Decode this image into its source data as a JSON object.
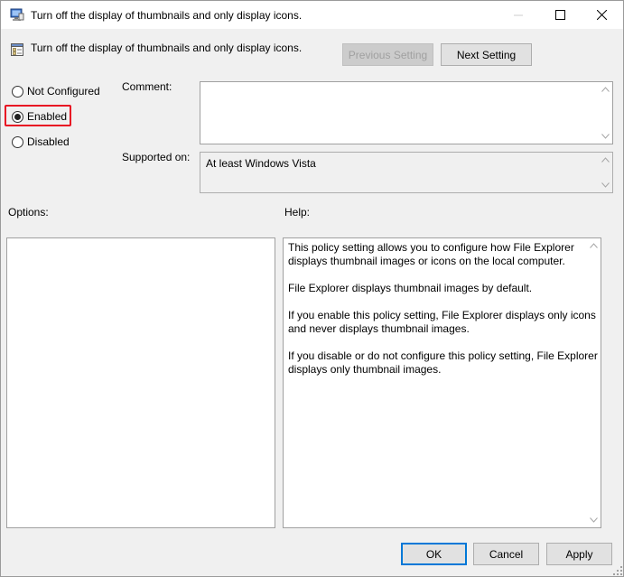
{
  "window": {
    "title": "Turn off the display of thumbnails and only display icons."
  },
  "header": {
    "policy_name": "Turn off the display of thumbnails and only display icons.",
    "previous_label": "Previous Setting",
    "next_label": "Next Setting"
  },
  "state": {
    "not_configured": "Not Configured",
    "enabled": "Enabled",
    "disabled": "Disabled",
    "selected": "Enabled"
  },
  "comment": {
    "label": "Comment:",
    "value": ""
  },
  "supported": {
    "label": "Supported on:",
    "value": "At least Windows Vista"
  },
  "options": {
    "label": "Options:"
  },
  "help": {
    "label": "Help:",
    "paragraphs": [
      "This policy setting allows you to configure how File Explorer displays thumbnail images or icons on the local computer.",
      "File Explorer displays thumbnail images by default.",
      "If you enable this policy setting, File Explorer displays only icons and never displays thumbnail images.",
      "If you disable or do not configure this policy setting, File Explorer displays only thumbnail images."
    ]
  },
  "footer": {
    "ok_label": "OK",
    "cancel_label": "Cancel",
    "apply_label": "Apply"
  },
  "colors": {
    "highlight": "#e81123",
    "default_button_border": "#0078d7"
  }
}
